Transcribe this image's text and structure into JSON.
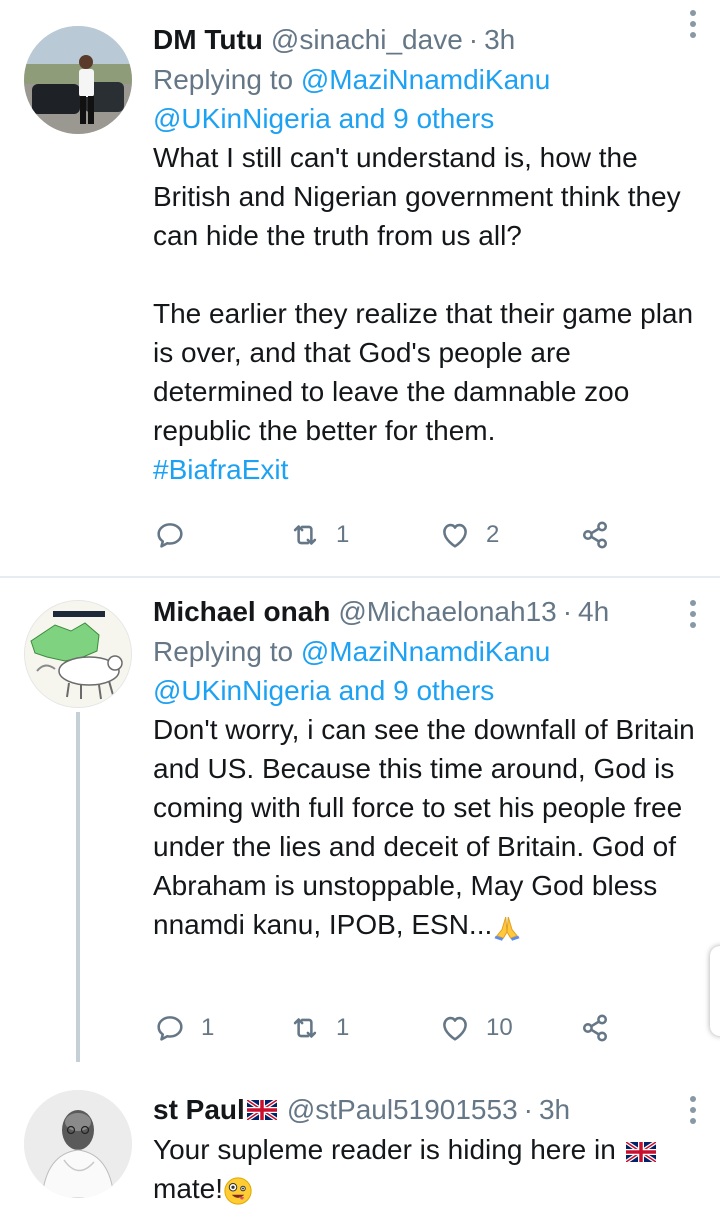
{
  "colors": {
    "text_primary": "#14171a",
    "text_secondary": "#657786",
    "link_blue": "#1da1f2",
    "divider": "#e6ecf0"
  },
  "tweets": [
    {
      "name": "DM Tutu",
      "handle": "@sinachi_dave",
      "separator": "·",
      "time": "3h",
      "replying_label": "Replying to",
      "replying_mention": "@MaziNnamdiKanu",
      "replying_line2": "@UKinNigeria and 9 others",
      "paragraph1": "What I still can't understand is, how the British and Nigerian government think they can hide the truth from us all?",
      "paragraph2": "The earlier they realize that their game plan is over, and that God's people are determined to leave the damnable zoo republic the better for them.",
      "hashtag": "#BiafraExit",
      "reply_count": "",
      "retweet_count": "1",
      "like_count": "2",
      "icons": [
        "reply-icon",
        "retweet-icon",
        "like-icon",
        "share-icon",
        "more-icon"
      ]
    },
    {
      "name": "Michael onah",
      "handle": "@Michaelonah13",
      "separator": "·",
      "time": "4h",
      "replying_label": "Replying to",
      "replying_mention": "@MaziNnamdiKanu",
      "replying_line2": "@UKinNigeria and 9 others",
      "text": "Don't worry, i can see the downfall of Britain and US. Because this time around, God is coming with full force to set his people free under the lies and deceit of Britain. God of Abraham is unstoppable, May God bless nnamdi kanu, IPOB, ESN...",
      "emoji": "folded-hands",
      "reply_count": "1",
      "retweet_count": "1",
      "like_count": "10",
      "icons": [
        "reply-icon",
        "retweet-icon",
        "like-icon",
        "share-icon",
        "more-icon"
      ]
    },
    {
      "name": "st Paul",
      "name_emoji": "uk-flag",
      "handle": "@stPaul51901553",
      "separator": "·",
      "time": "3h",
      "text_part1": "Your supleme reader is hiding here in",
      "text_emoji": "uk-flag",
      "text_part2": "mate!",
      "end_emoji": "zany-face"
    }
  ]
}
